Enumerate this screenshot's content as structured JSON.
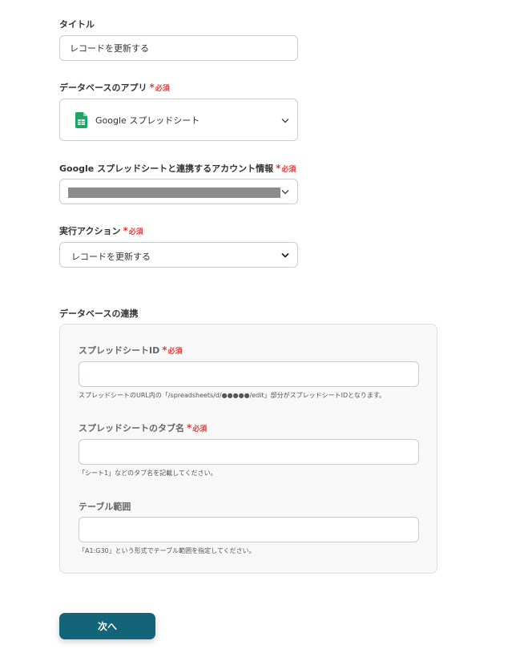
{
  "title_section": {
    "label": "タイトル",
    "value": "レコードを更新する"
  },
  "database_app": {
    "label": "データベースのアプリ",
    "required": "必須",
    "selected_app": "Google スプレッドシート",
    "app_icon": "google-sheets-icon"
  },
  "account": {
    "label": "Google スプレッドシートと連携するアカウント情報",
    "required": "必須",
    "value_redacted": true
  },
  "action": {
    "label": "実行アクション",
    "required": "必須",
    "selected": "レコードを更新する",
    "options": [
      "レコードを更新する"
    ]
  },
  "db_link": {
    "section_label": "データベースの連携",
    "sheet_id": {
      "label": "スプレッドシートID",
      "required": "必須",
      "value": "",
      "hint": "スプレッドシートのURL内の「/spreadsheets/d/●●●●●/edit」部分がスプレッドシートIDとなります。"
    },
    "tab_name": {
      "label": "スプレッドシートのタブ名",
      "required": "必須",
      "value": "",
      "hint": "「シート1」などのタブ名を記載してください。"
    },
    "table_range": {
      "label": "テーブル範囲",
      "value": "",
      "hint": "「A1:G30」という形式でテーブル範囲を指定してください。"
    }
  },
  "next_button": "次へ",
  "colors": {
    "primary": "#146479",
    "required": "#e23b3b",
    "sheets_green": "#1fa463"
  }
}
